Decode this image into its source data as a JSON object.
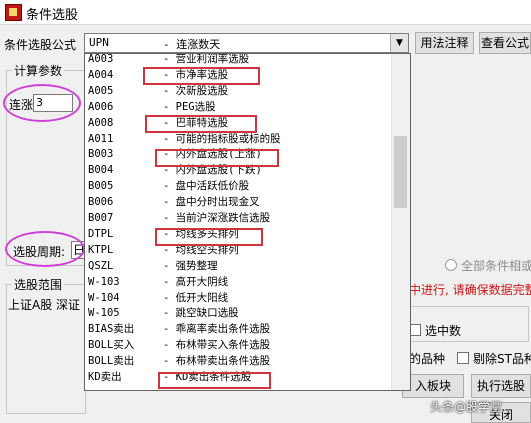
{
  "window": {
    "title": "条件选股"
  },
  "formula": {
    "label": "条件选股公式",
    "selected_code": "UPN",
    "selected_desc": "- 连涨数天",
    "usage_button": "用法注释",
    "view_button": "查看公式"
  },
  "calc_params": {
    "group_title": "计算参数",
    "param_label": "连涨",
    "param_value": "3",
    "period_label": "选股周期:",
    "period_value": "日"
  },
  "scope": {
    "group_title": "选股范围",
    "markets_text": "上证A股  深证"
  },
  "dropdown": {
    "items": [
      {
        "code": "A003",
        "desc": "- 营业利润率选股"
      },
      {
        "code": "A004",
        "desc": "- 市净率选股"
      },
      {
        "code": "A005",
        "desc": "- 次新股选股"
      },
      {
        "code": "A006",
        "desc": "- PEG选股"
      },
      {
        "code": "A008",
        "desc": "- 巴菲特选股"
      },
      {
        "code": "A011",
        "desc": "- 可能的指标股或标的股"
      },
      {
        "code": "B003",
        "desc": "- 内外盘选股(上涨)"
      },
      {
        "code": "B004",
        "desc": "- 内外盘选股(下跌)"
      },
      {
        "code": "B005",
        "desc": "- 盘中活跃低价股"
      },
      {
        "code": "B006",
        "desc": "- 盘中分时出现金叉"
      },
      {
        "code": "B007",
        "desc": "- 当前沪深涨跌信选股"
      },
      {
        "code": "DTPL",
        "desc": "- 均线多头排列"
      },
      {
        "code": "KTPL",
        "desc": "- 均线空头排列"
      },
      {
        "code": "QSZL",
        "desc": "- 强势整理"
      },
      {
        "code": "W-103",
        "desc": "- 高开大阴线"
      },
      {
        "code": "W-104",
        "desc": "- 低开大阳线"
      },
      {
        "code": "W-105",
        "desc": "- 跳空缺口选股"
      },
      {
        "code": "BIAS卖出",
        "desc": "- 乖离率卖出条件选股"
      },
      {
        "code": "BOLL买入",
        "desc": "- 布林带买入条件选股"
      },
      {
        "code": "BOLL卖出",
        "desc": "- 布林带卖出条件选股"
      },
      {
        "code": "KD卖出",
        "desc": "- KD卖出条件选股"
      }
    ]
  },
  "right_panel": {
    "radio_all_conditions": "全部条件相或",
    "warning_text": "中进行, 请确保数据完整",
    "checkbox_in_count": "选中数",
    "stock_types_label": "的品种",
    "exclude_st_label": "剔除ST品种",
    "import_block_button": "入板块",
    "execute_button": "执行选股",
    "close_button": "关闭"
  },
  "watermark": "头条@股学堂",
  "colors": {
    "highlight_box": "#d0343c",
    "ellipse": "#d040d8",
    "warning": "#d01414"
  }
}
